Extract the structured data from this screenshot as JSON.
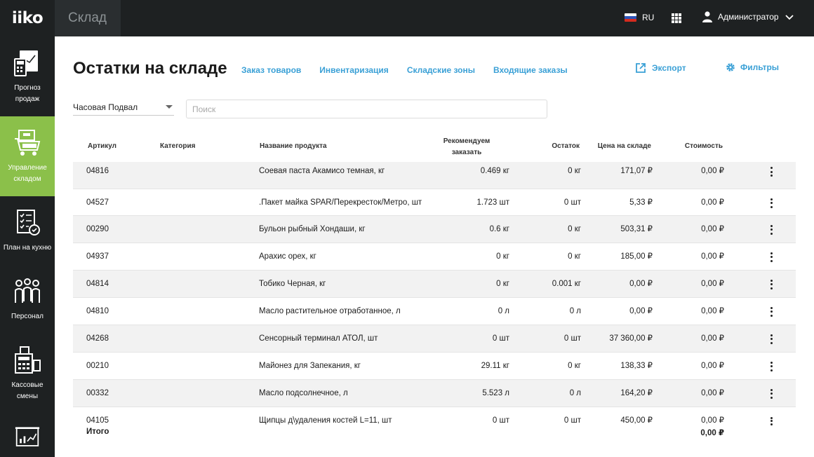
{
  "header": {
    "logo": "iiko",
    "section_title": "Склад",
    "language": "RU",
    "user_name": "Администратор"
  },
  "sidebar": {
    "items": [
      {
        "label": "Прогноз продаж",
        "icon": "sales-forecast-icon",
        "active": false
      },
      {
        "label": "Управление складом",
        "icon": "warehouse-cart-icon",
        "active": true
      },
      {
        "label": "План на кухню",
        "icon": "kitchen-plan-icon",
        "active": false
      },
      {
        "label": "Персонал",
        "icon": "staff-icon",
        "active": false
      },
      {
        "label": "Кассовые смены",
        "icon": "cash-register-icon",
        "active": false
      },
      {
        "label": "",
        "icon": "reports-chart-icon",
        "active": false
      }
    ]
  },
  "main": {
    "title": "Остатки на складе",
    "tabs": [
      "Заказ товаров",
      "Инвентаризация",
      "Складские зоны",
      "Входящие заказы"
    ],
    "export_label": "Экспорт",
    "filters_label": "Фильтры",
    "store_selected": "Часовая Подвал",
    "search_placeholder": "Поиск"
  },
  "table": {
    "headers": {
      "article": "Артикул",
      "category": "Категория",
      "name": "Название продукта",
      "recommended_line1": "Рекомендуем",
      "recommended_line2": "заказать",
      "rest": "Остаток",
      "price": "Цена на складе",
      "cost": "Стоимость"
    },
    "rows": [
      {
        "article": "04816",
        "category": "",
        "name": "Соевая паста Акамисо темная, кг",
        "recommended": "0.469 кг",
        "rest": "0 кг",
        "price": "171,07 ₽",
        "cost": "0,00 ₽"
      },
      {
        "article": "04527",
        "category": "",
        "name": ".Пакет майка SPAR/Перекресток/Метро, шт",
        "recommended": "1.723 шт",
        "rest": "0 шт",
        "price": "5,33 ₽",
        "cost": "0,00 ₽"
      },
      {
        "article": "00290",
        "category": "",
        "name": "Бульон рыбный Хондаши, кг",
        "recommended": "0.6 кг",
        "rest": "0 кг",
        "price": "503,31 ₽",
        "cost": "0,00 ₽"
      },
      {
        "article": "04937",
        "category": "",
        "name": "Арахис орех, кг",
        "recommended": "0 кг",
        "rest": "0 кг",
        "price": "185,00 ₽",
        "cost": "0,00 ₽"
      },
      {
        "article": "04814",
        "category": "",
        "name": "Тобико Черная, кг",
        "recommended": "0 кг",
        "rest": "0.001 кг",
        "price": "0,00 ₽",
        "cost": "0,00 ₽"
      },
      {
        "article": "04810",
        "category": "",
        "name": "Масло растительное отработанное, л",
        "recommended": "0 л",
        "rest": "0 л",
        "price": "0,00 ₽",
        "cost": "0,00 ₽"
      },
      {
        "article": "04268",
        "category": "",
        "name": "Сенсорный терминал АТОЛ, шт",
        "recommended": "0 шт",
        "rest": "0 шт",
        "price": "37 360,00 ₽",
        "cost": "0,00 ₽"
      },
      {
        "article": "00210",
        "category": "",
        "name": "Майонез для Запекания, кг",
        "recommended": "29.11 кг",
        "rest": "0 кг",
        "price": "138,33 ₽",
        "cost": "0,00 ₽"
      },
      {
        "article": "00332",
        "category": "",
        "name": "Масло подсолнечное, л",
        "recommended": "5.523 л",
        "rest": "0 л",
        "price": "164,20 ₽",
        "cost": "0,00 ₽"
      },
      {
        "article": "04105",
        "category": "",
        "name": "Щипцы д\\удаления костей L=11, шт",
        "recommended": "0 шт",
        "rest": "0 шт",
        "price": "450,00 ₽",
        "cost": "0,00 ₽"
      }
    ],
    "total_label": "Итого",
    "total_value": "0,00 ₽"
  },
  "colors": {
    "accent": "#3aa0d6",
    "active_nav": "#8bc04a",
    "dark_bar": "#1e2122"
  }
}
